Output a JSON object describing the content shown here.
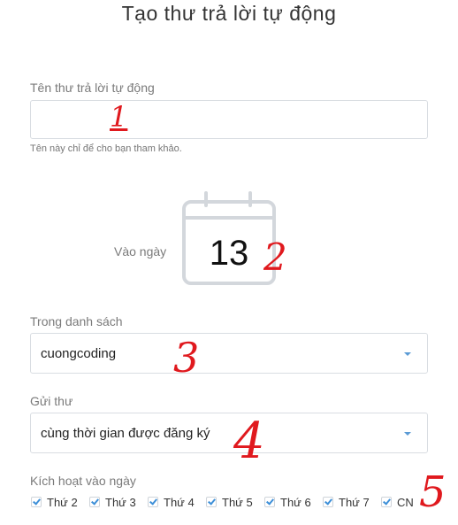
{
  "page": {
    "title": "Tạo thư trả lời tự động"
  },
  "name_field": {
    "label": "Tên thư trả lời tự động",
    "value": "",
    "hint": "Tên này chỉ để cho bạn tham khảo."
  },
  "date": {
    "label": "Vào ngày",
    "day": "13"
  },
  "list_field": {
    "label": "Trong danh sách",
    "value": "cuongcoding"
  },
  "send_field": {
    "label": "Gửi thư",
    "value": "cùng thời gian được đăng ký"
  },
  "activate": {
    "label": "Kích hoạt vào ngày",
    "days": [
      {
        "label": "Thứ 2",
        "checked": true
      },
      {
        "label": "Thứ 3",
        "checked": true
      },
      {
        "label": "Thứ 4",
        "checked": true
      },
      {
        "label": "Thứ 5",
        "checked": true
      },
      {
        "label": "Thứ 6",
        "checked": true
      },
      {
        "label": "Thứ 7",
        "checked": true
      },
      {
        "label": "CN",
        "checked": true
      }
    ]
  },
  "annotations": [
    "1",
    "2",
    "3",
    "4",
    "5"
  ],
  "colors": {
    "accent": "#3d8fd8",
    "annotation": "#e0191e",
    "border": "#d9dde2"
  }
}
